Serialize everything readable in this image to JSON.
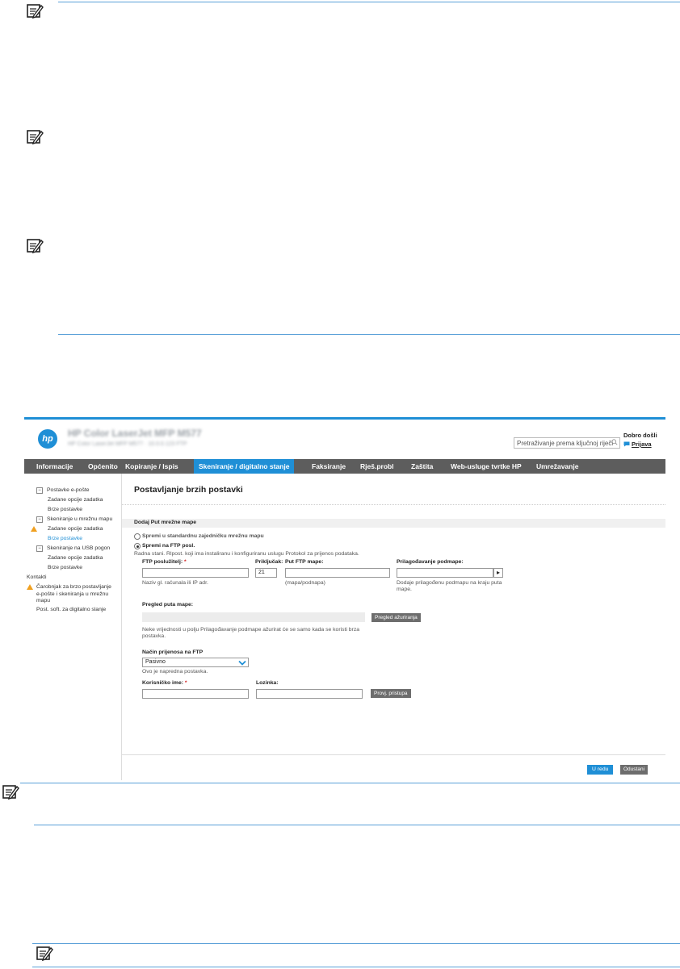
{
  "hp": {
    "logo_text": "hp",
    "product_name": "HP Color LaserJet MFP M577",
    "product_sub": "HP Color LaserJet MFP M577 · 10.0.0.123 FTP",
    "search_placeholder": "Pretraživanje prema ključnoj riječi",
    "welcome": "Dobro došli",
    "login": "Prijava",
    "tabs": [
      "Informacije",
      "Općenito",
      "Kopiranje / Ispis",
      "Skeniranje / digitalno stanje",
      "Faksiranje",
      "Rješ.probl",
      "Zaštita",
      "Web-usluge tvrtke HP",
      "Umrežavanje"
    ],
    "active_tab": "Skeniranje / digitalno stanje"
  },
  "sidebar": {
    "email_group": "Postavke e-pošte",
    "email_default": "Zadane opcije zadatka",
    "email_quick": "Brze postavke",
    "folder_group": "Skeniranje u mrežnu mapu",
    "folder_default": "Zadane opcije zadatka",
    "folder_quick": "Brze postavke",
    "usb_group": "Skeniranje na USB pogon",
    "usb_default": "Zadane opcije zadatka",
    "usb_quick": "Brze postavke",
    "contacts": "Kontakti",
    "wizard": "Čarobnjak za brzo postavljanje e-pošte i skeniranja u mrežnu mapu",
    "software": "Post. soft. za digitalno slanje"
  },
  "main": {
    "page_title": "Postavljanje brzih postavki",
    "section_title": "Dodaj Put mrežne mape",
    "radio_shared": "Spremi u standardnu zajedničku mrežnu mapu",
    "radio_ftp": "Spremi na FTP posl.",
    "ftp_note": "Radna stani. Rlpost. koji ima instaliranu i konfiguriranu uslugu Protokol za prijenos podataka.",
    "ftp_server_label": "FTP poslužitelj:",
    "required_mark": "*",
    "port_label": "Priključak:",
    "port_value": "21",
    "ftp_path_label": "Put FTP mape:",
    "subfolder_label": "Prilagođavanje podmape:",
    "ftp_server_hint": "Naziv gl. računala ili IP adr.",
    "ftp_path_hint": "(mapa/podnapa)",
    "subfolder_hint": "Dodaje prilagođenu podmapu na kraju puta mape.",
    "preview_label": "Pregled puta mape:",
    "preview_button": "Pregled ažuriranja",
    "preview_hint": "Neke vrijednosti u polju Prilagođavanje podmape ažurirat će se samo kada se koristi brza postavka.",
    "transfer_label": "Način prijenosa na FTP",
    "transfer_value": "Pasivno",
    "transfer_hint": "Ovo je napredna postavka.",
    "username_label": "Korisničko ime:",
    "password_label": "Lozinka:",
    "verify_button": "Provj. pristupa",
    "ok_button": "U redu",
    "cancel_button": "Odustani"
  }
}
